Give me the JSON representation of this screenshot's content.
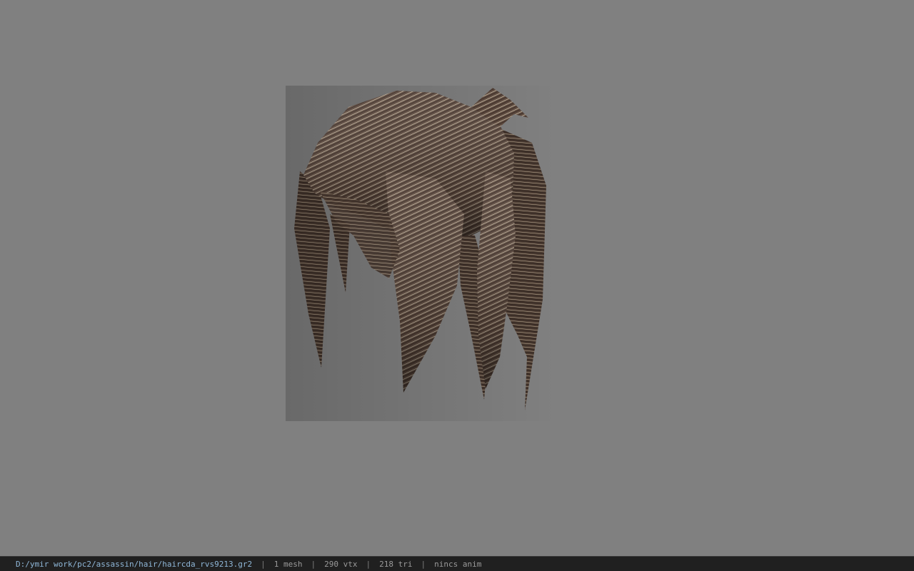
{
  "viewer": {
    "background_color": "#808080",
    "model": {
      "description_icon": "hair-mesh-icon",
      "colors": {
        "dark": "#3a2d26",
        "mid": "#6e5a4e",
        "light": "#d9cdb6"
      }
    }
  },
  "statusbar": {
    "file_path": "D:/ymir work/pc2/assassin/hair/haircda_rvs9213.gr2",
    "separator": "|",
    "mesh_count": "1 mesh",
    "vertex_count": "290 vtx",
    "triangle_count": "218 tri",
    "anim": "nincs anim"
  }
}
